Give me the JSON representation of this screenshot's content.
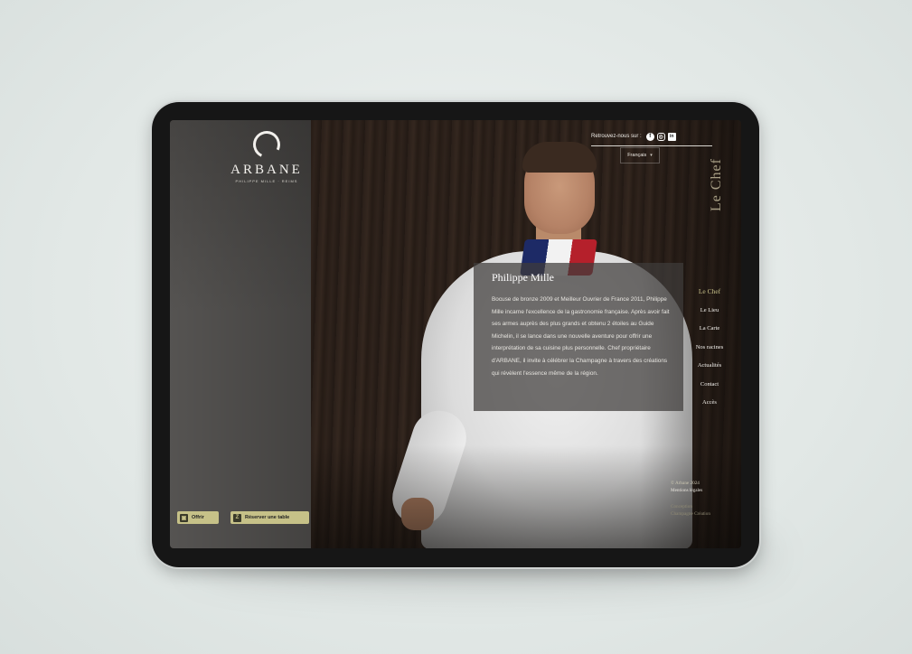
{
  "brand": {
    "name": "ARBANE",
    "subtitle": "PHILIPPE MILLE · REIMS"
  },
  "topbar": {
    "follow_label": "Retrouvez-nous sur :",
    "social": [
      {
        "name": "facebook-icon",
        "glyph": "f"
      },
      {
        "name": "instagram-icon",
        "glyph": "◎"
      },
      {
        "name": "linkedin-icon",
        "glyph": "in"
      }
    ]
  },
  "language": {
    "selected": "Français",
    "chevron": "▾"
  },
  "page": {
    "vertical_title": "Le Chef"
  },
  "chef": {
    "name": "Philippe Mille",
    "bio": "Bocuse de bronze 2009 et Meilleur Ouvrier de France 2011, Philippe Mille incarne l'excellence de la gastronomie française. Après avoir fait ses armes auprès des plus grands et obtenu 2 étoiles au Guide Michelin, il se lance dans une nouvelle aventure pour offrir une interprétation de sa cuisine plus personnelle. Chef propriétaire d'ARBANE, il invite à célébrer la Champagne à travers des créations qui révèlent l'essence même de la région."
  },
  "nav": {
    "items": [
      "Le Chef",
      "Le Lieu",
      "La Carte",
      "Nos racines",
      "Actualités",
      "Contact",
      "Accès"
    ]
  },
  "footer": {
    "copyright": "© Arbane 2024",
    "legal": "Mentions légales",
    "credit1": "Conception",
    "credit2": "Champagne Création"
  },
  "actions": {
    "offer_label": "Offrir",
    "offer_icon": "gift-icon",
    "reserve_label": "Réserver une table",
    "reserve_icon": "zenchef-icon",
    "reserve_glyph": "Z",
    "offer_glyph": "▣"
  },
  "colors": {
    "accent": "#c6c188",
    "active_nav": "#c7c18a",
    "vertical_title": "#a79e85"
  }
}
